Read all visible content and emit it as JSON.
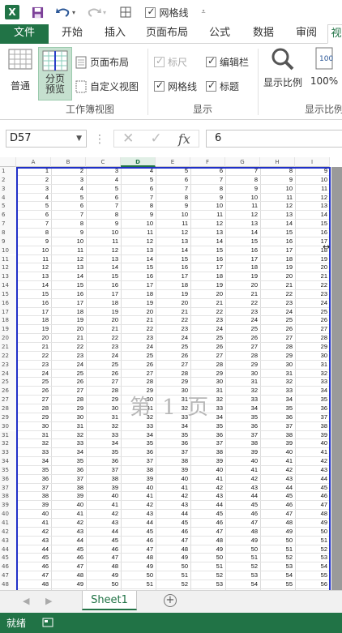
{
  "qat": {
    "autosave_label": "网格线",
    "app_logo": "X"
  },
  "tabs": [
    "文件",
    "开始",
    "插入",
    "页面布局",
    "公式",
    "数据",
    "审阅",
    "视"
  ],
  "ribbon": {
    "normal": "普通",
    "page_break_preview_l1": "分页",
    "page_break_preview_l2": "预览",
    "page_layout": "页面布局",
    "custom_views": "自定义视图",
    "group_workbook_views": "工作簿视图",
    "ruler": "标尺",
    "formula_bar": "编辑栏",
    "gridlines": "网格线",
    "headings": "标题",
    "group_show": "显示",
    "zoom": "显示比例",
    "zoom_100": "100%",
    "group_zoom": "显示比例"
  },
  "formula_bar": {
    "name_box": "D57",
    "fx": "fx",
    "value": "6"
  },
  "columns": [
    "A",
    "B",
    "C",
    "D",
    "E",
    "F",
    "G",
    "H",
    "I"
  ],
  "selected_column": "D",
  "rows_start": 1,
  "rows_count": 49,
  "page_watermark": "第 1 页",
  "sheet_tab": "Sheet1",
  "status": {
    "ready": "就绪"
  }
}
